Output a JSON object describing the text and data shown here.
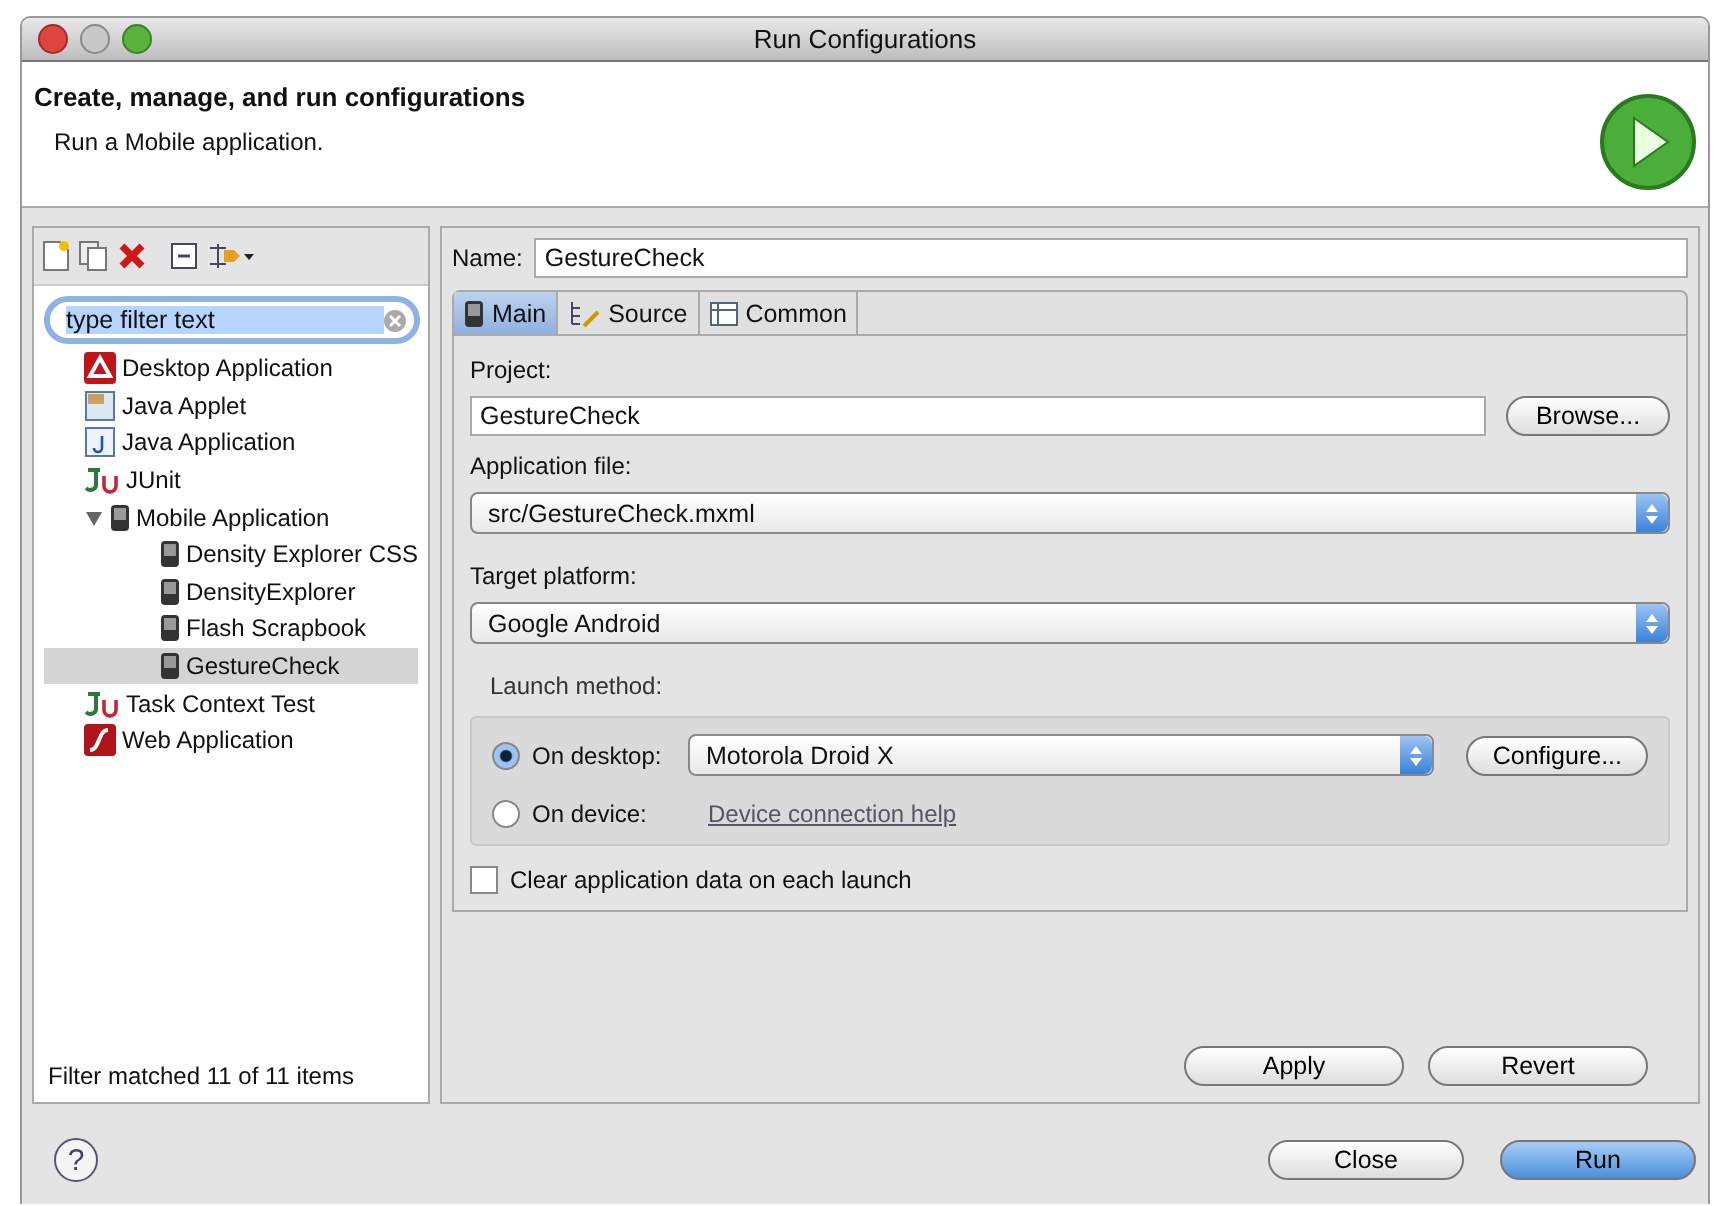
{
  "window": {
    "title": "Run Configurations"
  },
  "header": {
    "title": "Create, manage, and run configurations",
    "subtitle": "Run a Mobile application."
  },
  "filter": {
    "value": "type filter text"
  },
  "tree": [
    {
      "label": "Desktop Application",
      "kind": "desktop",
      "selected": false
    },
    {
      "label": "Java Applet",
      "kind": "applet",
      "selected": false
    },
    {
      "label": "Java Application",
      "kind": "java",
      "selected": false
    },
    {
      "label": "JUnit",
      "kind": "junit",
      "selected": false
    },
    {
      "label": "Mobile Application",
      "kind": "mobile",
      "selected": false,
      "expanded": true,
      "children": [
        {
          "label": "Density Explorer CSS",
          "kind": "mobile",
          "selected": false
        },
        {
          "label": "DensityExplorer",
          "kind": "mobile",
          "selected": false
        },
        {
          "label": "Flash Scrapbook",
          "kind": "mobile",
          "selected": false
        },
        {
          "label": "GestureCheck",
          "kind": "mobile",
          "selected": true
        }
      ]
    },
    {
      "label": "Task Context Test",
      "kind": "junit",
      "selected": false
    },
    {
      "label": "Web Application",
      "kind": "web",
      "selected": false
    }
  ],
  "filter_status": "Filter matched 11 of 11 items",
  "name": {
    "label": "Name:",
    "value": "GestureCheck"
  },
  "tabs": [
    {
      "label": "Main",
      "kind": "phone",
      "selected": true
    },
    {
      "label": "Source",
      "kind": "source",
      "selected": false
    },
    {
      "label": "Common",
      "kind": "table",
      "selected": false
    }
  ],
  "project": {
    "label": "Project:",
    "value": "GestureCheck",
    "button": "Browse..."
  },
  "application_file": {
    "label": "Application file:",
    "value": "src/GestureCheck.mxml"
  },
  "target_platform": {
    "label": "Target platform:",
    "value": "Google Android"
  },
  "launch_method": {
    "label": "Launch method:",
    "options": [
      {
        "label": "On desktop:",
        "selected": true,
        "device": "Motorola Droid X",
        "button": "Configure..."
      },
      {
        "label": "On device:",
        "selected": false,
        "link": "Device connection help"
      }
    ]
  },
  "clear_data": {
    "label": "Clear application data on each launch",
    "checked": false
  },
  "actions": [
    "Apply",
    "Revert"
  ],
  "footer": {
    "help": "?",
    "buttons": [
      {
        "label": "Close",
        "default": false
      },
      {
        "label": "Run",
        "default": true
      }
    ]
  }
}
